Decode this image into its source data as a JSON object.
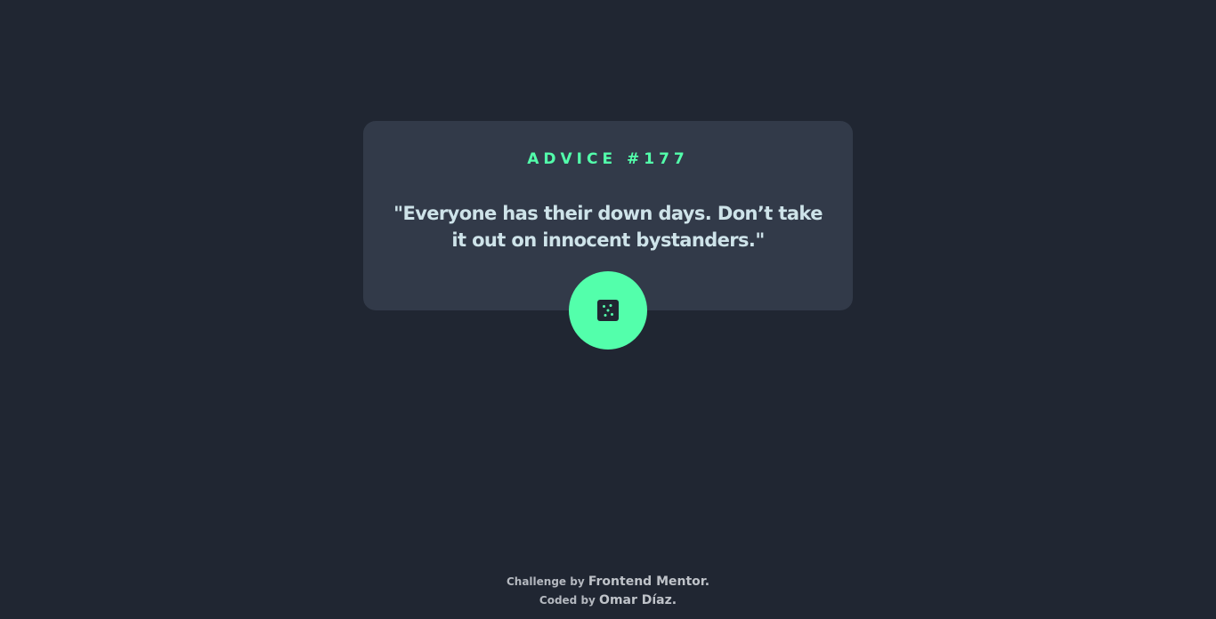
{
  "card": {
    "advice_label": "ADVICE #177",
    "quote": "\"Everyone has their down days. Don’t take it out on innocent bystanders.\""
  },
  "dice_button": {
    "icon": "dice-icon"
  },
  "footer": {
    "challenge_prefix": "Challenge by",
    "challenge_link": "Frontend Mentor",
    "coded_prefix": "Coded by",
    "coded_link": "Omar Díaz",
    "period": "."
  },
  "colors": {
    "background": "#202632",
    "card": "#323a49",
    "accent": "#53ffab",
    "quote_text": "#cee3e9"
  }
}
